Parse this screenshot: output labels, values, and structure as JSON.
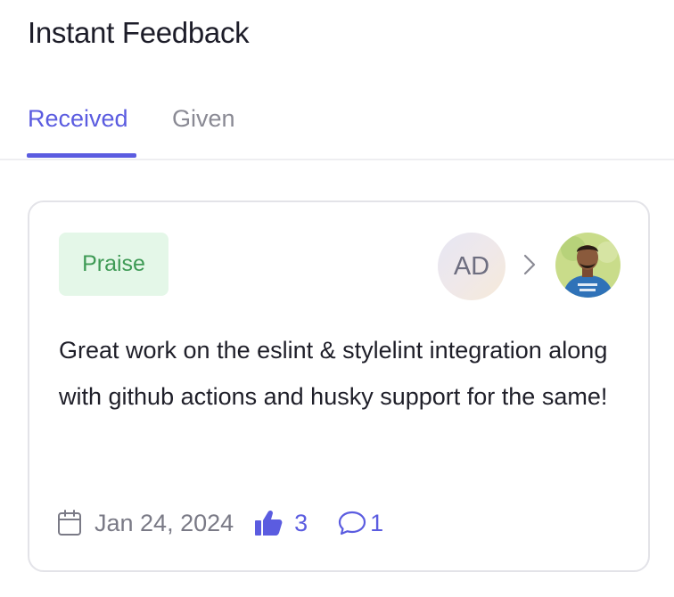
{
  "header": {
    "title": "Instant Feedback"
  },
  "tabs": [
    {
      "label": "Received",
      "active": true
    },
    {
      "label": "Given",
      "active": false
    }
  ],
  "feedback": {
    "badge": "Praise",
    "sender_initials": "AD",
    "recipient_avatar_icon": "user-photo",
    "message": "Great work on the eslint & stylelint integration along with github actions and husky support for the same!",
    "date": "Jan 24, 2024",
    "likes": "3",
    "comments": "1"
  },
  "colors": {
    "accent": "#5b5ce0",
    "praise_bg": "#e4f7e8",
    "praise_text": "#3e9a55"
  },
  "icons": [
    "calendar-icon",
    "thumbs-up-icon",
    "comment-icon",
    "chevron-right-icon"
  ]
}
